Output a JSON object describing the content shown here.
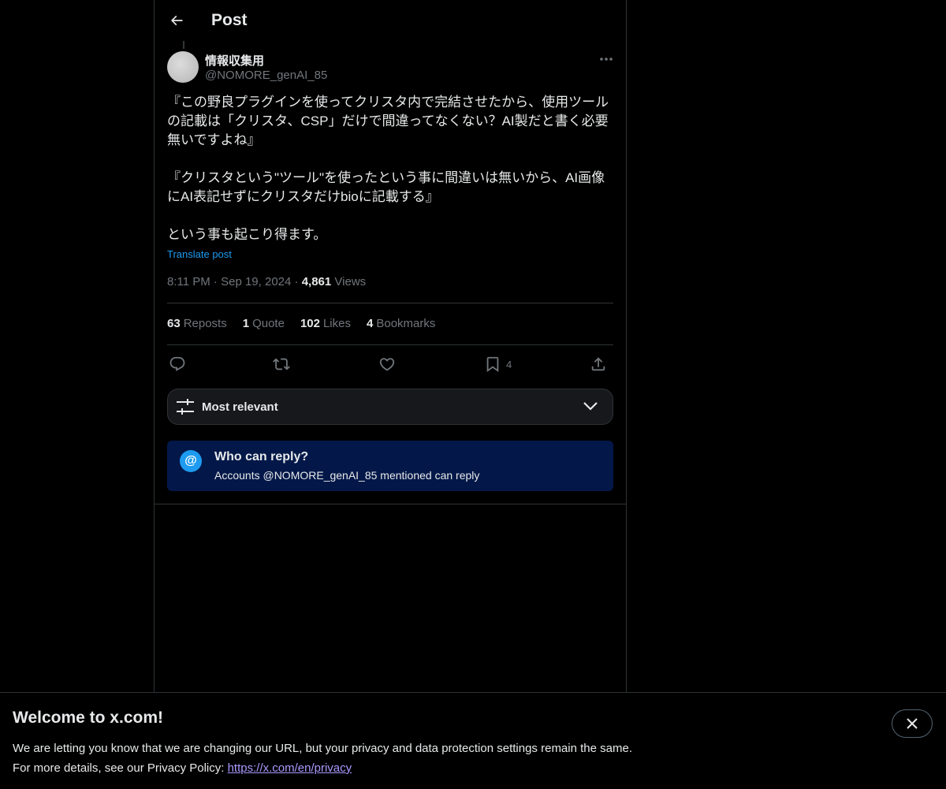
{
  "header": {
    "title": "Post"
  },
  "post": {
    "display_name": "情報収集用",
    "handle": "@NOMORE_genAI_85",
    "paragraphs": [
      "『この野良プラグインを使ってクリスタ内で完結させたから、使用ツールの記載は「クリスタ、CSP」だけで間違ってなくない？AI製だと書く必要無いですよね』",
      "『クリスタという\"ツール\"を使ったという事に間違いは無いから、AI画像にAI表記せずにクリスタだけbioに記載する』",
      "という事も起こり得ます。"
    ],
    "translate": "Translate post",
    "time": "8:11 PM",
    "dot1": "·",
    "date": "Sep 19, 2024",
    "dot2": "·",
    "views_count": "4,861",
    "views_label": "Views"
  },
  "stats": {
    "reposts_count": "63",
    "reposts_label": "Reposts",
    "quote_count": "1",
    "quote_label": "Quote",
    "likes_count": "102",
    "likes_label": "Likes",
    "bookmarks_count": "4",
    "bookmarks_label": "Bookmarks"
  },
  "actions": {
    "bookmark_count": "4"
  },
  "sort": {
    "label": "Most relevant"
  },
  "reply_info": {
    "icon": "@",
    "title": "Who can reply?",
    "subtitle": "Accounts @NOMORE_genAI_85 mentioned can reply"
  },
  "banner": {
    "title": "Welcome to x.com!",
    "line1": "We are letting you know that we are changing our URL, but your privacy and data protection settings remain the same.",
    "line2_prefix": "For more details, see our Privacy Policy: ",
    "link": "https://x.com/en/privacy"
  },
  "colors": {
    "background": "#000000",
    "accent": "#1d9bf0",
    "reply_box": "#031849",
    "muted": "#71767b"
  }
}
